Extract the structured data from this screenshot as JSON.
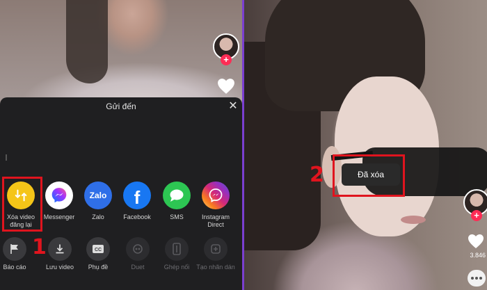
{
  "share_sheet": {
    "title": "Gửi đến",
    "share_targets": [
      {
        "label": "Xóa video đăng lại",
        "icon": "repost-icon",
        "color": "#f5c518"
      },
      {
        "label": "Messenger",
        "icon": "messenger-icon",
        "color": "#ffffff"
      },
      {
        "label": "Zalo",
        "icon": "zalo-icon",
        "color": "#0068ff"
      },
      {
        "label": "Facebook",
        "icon": "facebook-icon",
        "color": "#1877f2"
      },
      {
        "label": "SMS",
        "icon": "sms-icon",
        "color": "#2dc653"
      },
      {
        "label": "Instagram Direct",
        "icon": "instagram-direct-icon",
        "color": "#d62976"
      }
    ],
    "actions": [
      {
        "label": "Báo cáo",
        "icon": "flag-icon",
        "enabled": true
      },
      {
        "label": "Lưu video",
        "icon": "download-icon",
        "enabled": true
      },
      {
        "label": "Phụ đề",
        "icon": "captions-icon",
        "enabled": true
      },
      {
        "label": "Duet",
        "icon": "duet-icon",
        "enabled": false
      },
      {
        "label": "Ghép nối",
        "icon": "stitch-icon",
        "enabled": false
      },
      {
        "label": "Tạo nhãn dán",
        "icon": "sticker-icon",
        "enabled": false
      }
    ]
  },
  "annotations": {
    "step1": "1",
    "step2": "2",
    "highlight_color": "#e0141e"
  },
  "toast": {
    "text": "Đã xóa"
  },
  "video_right": {
    "like_count": "3.846"
  },
  "colors": {
    "accent": "#fe2c55"
  }
}
